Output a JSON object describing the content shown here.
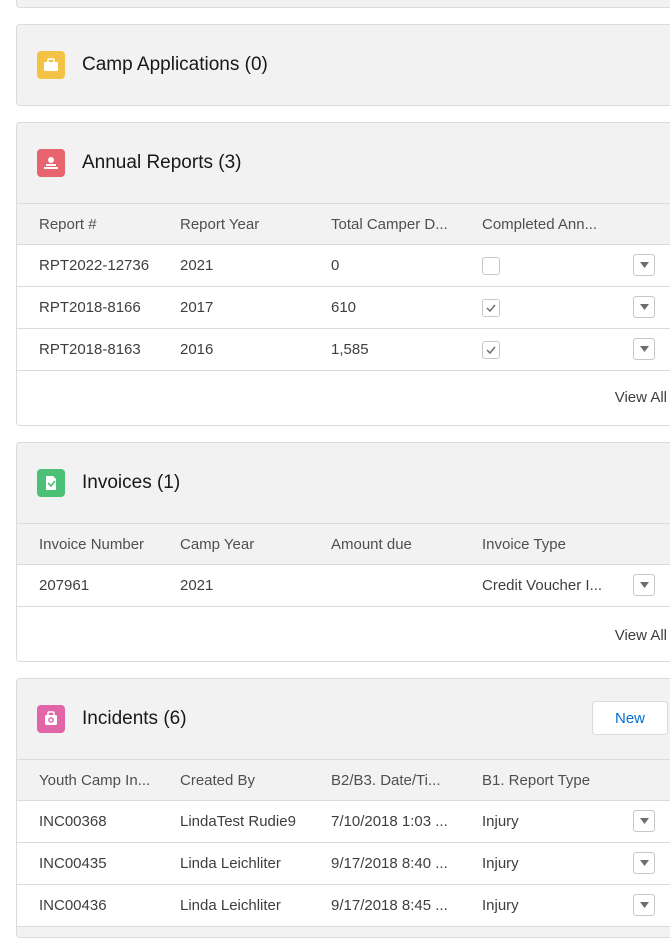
{
  "camp_applications": {
    "title": "Camp Applications (0)",
    "icon": "briefcase-icon",
    "color": "#f4c345"
  },
  "annual_reports": {
    "title": "Annual Reports (3)",
    "icon": "report-icon",
    "color": "#e8646f",
    "columns": [
      "Report #",
      "Report Year",
      "Total Camper D...",
      "Completed Ann..."
    ],
    "rows": [
      {
        "report": "RPT2022-12736",
        "year": "2021",
        "total": "0",
        "completed": false
      },
      {
        "report": "RPT2018-8166",
        "year": "2017",
        "total": "610",
        "completed": true
      },
      {
        "report": "RPT2018-8163",
        "year": "2016",
        "total": "1,585",
        "completed": true
      }
    ],
    "view_all": "View All"
  },
  "invoices": {
    "title": "Invoices (1)",
    "icon": "invoice-icon",
    "color": "#4bc076",
    "columns": [
      "Invoice Number",
      "Camp Year",
      "Amount due",
      "Invoice Type"
    ],
    "rows": [
      {
        "number": "207961",
        "year": "2021",
        "amount": "",
        "type": "Credit Voucher I..."
      }
    ],
    "view_all": "View All"
  },
  "incidents": {
    "title": "Incidents (6)",
    "icon": "incident-icon",
    "color": "#e066a8",
    "new_label": "New",
    "columns": [
      "Youth Camp In...",
      "Created By",
      "B2/B3. Date/Ti...",
      "B1. Report Type"
    ],
    "rows": [
      {
        "id": "INC00368",
        "created_by": "LindaTest Rudie9",
        "datetime": "7/10/2018 1:03 ...",
        "type": "Injury"
      },
      {
        "id": "INC00435",
        "created_by": "Linda Leichliter",
        "datetime": "9/17/2018 8:40 ...",
        "type": "Injury"
      },
      {
        "id": "INC00436",
        "created_by": "Linda Leichliter",
        "datetime": "9/17/2018 8:45 ...",
        "type": "Injury"
      }
    ]
  }
}
